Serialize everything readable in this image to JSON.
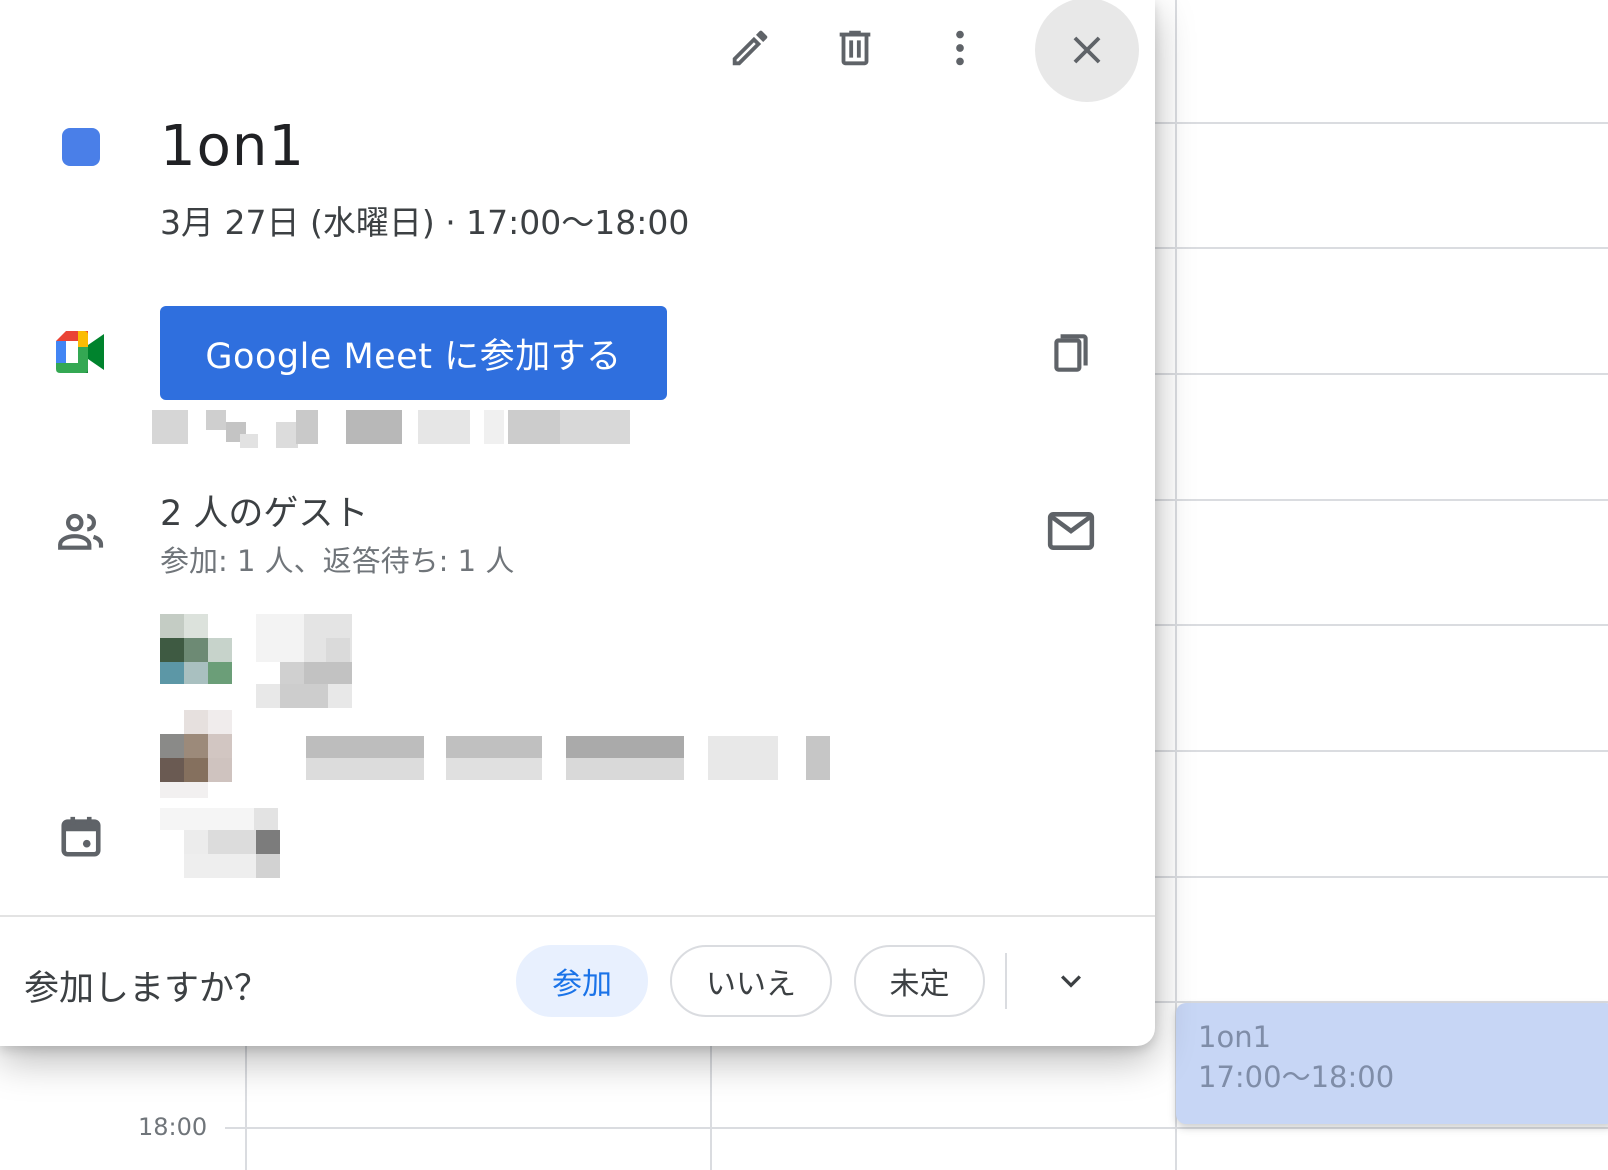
{
  "toolbar": {
    "edit_icon": "pencil-icon",
    "delete_icon": "trash-icon",
    "more_icon": "more-vert-icon",
    "close_icon": "close-icon"
  },
  "event": {
    "color": "#4a7fe8",
    "title": "1on1",
    "datetime": "3月 27日 (水曜日)  ·  17:00〜18:00"
  },
  "meet": {
    "button_label": "Google Meet に参加する",
    "copy_icon": "copy-icon"
  },
  "guests": {
    "title": "2 人のゲスト",
    "summary": "参加: 1 人、返答待ち: 1 人",
    "email_icon": "mail-icon"
  },
  "rsvp": {
    "question": "参加しますか？",
    "options": [
      "参加",
      "いいえ",
      "未定"
    ],
    "selected": "参加",
    "accent": "#1a73e8"
  },
  "background": {
    "time_label": "18:00",
    "event_title": "1on1",
    "event_time": "17:00〜18:00"
  }
}
